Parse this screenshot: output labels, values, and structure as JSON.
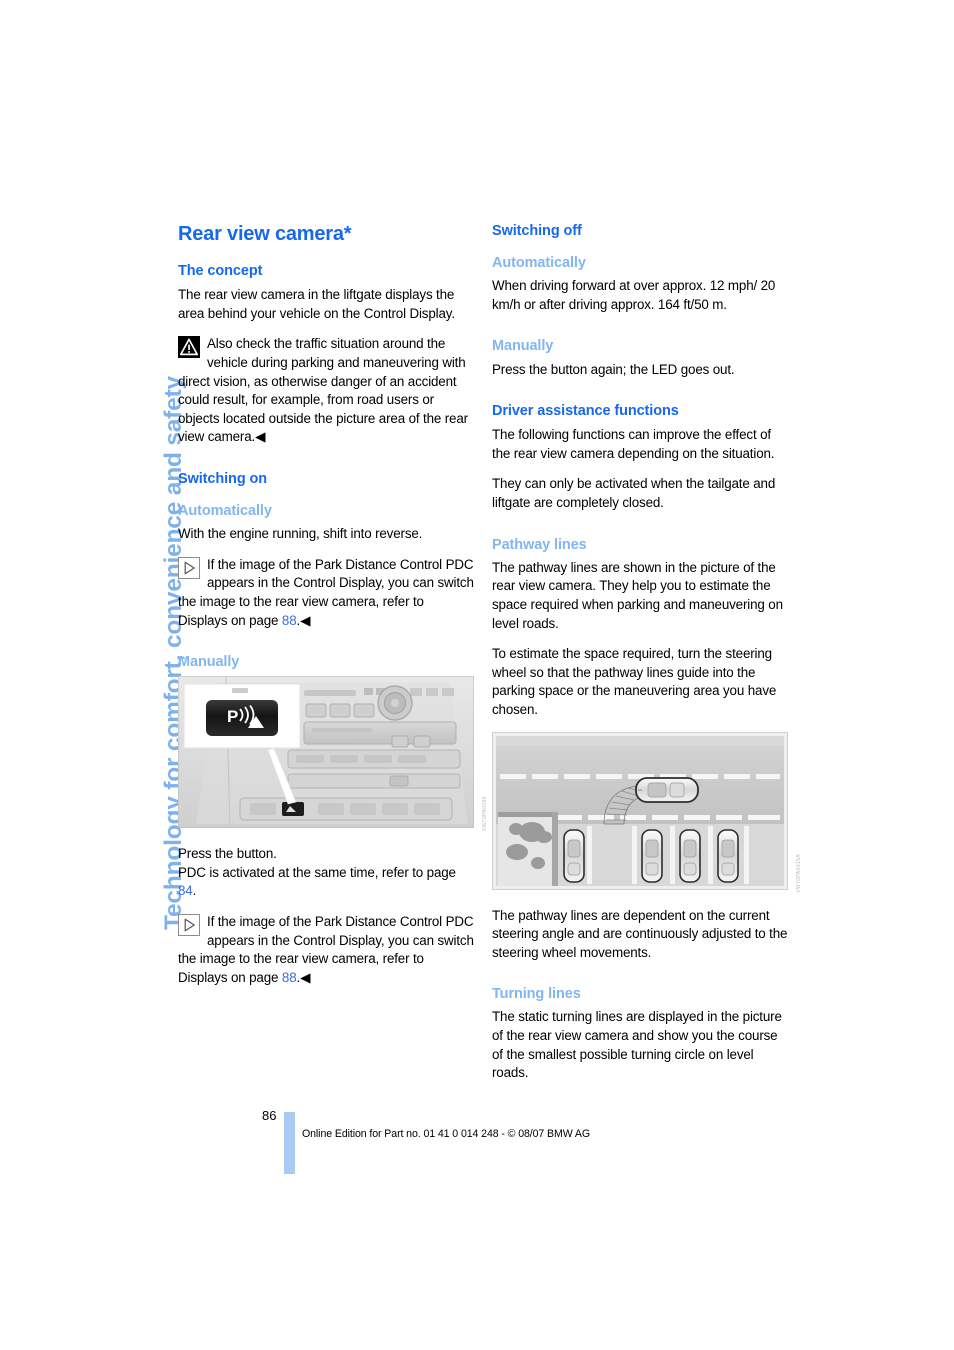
{
  "chapter_tab": "Technology for comfort, convenience and safety",
  "colors": {
    "heading_blue": "#1668f0",
    "subheading_blue": "#82b6ef",
    "page_ref_blue": "#3a6fe0",
    "footer_bar_blue": "#a8cbf2"
  },
  "left_column": {
    "title": "Rear view camera*",
    "section_concept": {
      "heading": "The concept",
      "paragraph": "The rear view camera in the liftgate displays the area behind your vehicle on the Control Display.",
      "warning": {
        "icon": "warning-triangle-icon",
        "text": "Also check the traffic situation around the vehicle during parking and maneuvering with direct vision, as otherwise danger of an accident could result, for example, from road users or objects located outside the picture area of the rear view camera.",
        "endmark": "◀"
      }
    },
    "section_switching_on": {
      "heading": "Switching on",
      "automatically": {
        "heading": "Automatically",
        "paragraph": "With the engine running, shift into reverse.",
        "note": {
          "icon": "info-play-icon",
          "text_before_ref": "If the image of the Park Distance Control PDC appears in the Control Display, you can switch the image to the rear view camera, refer to Displays on page ",
          "page_ref": "88",
          "text_after_ref": ".",
          "endmark": "◀"
        }
      },
      "manually": {
        "heading": "Manually",
        "figure": {
          "name": "pdc-button-center-console-photo",
          "watermark": "VW70PA0096"
        },
        "paragraph_line1": "Press the button.",
        "paragraph_line2_before_ref": "PDC is activated at the same time, refer to page ",
        "paragraph_line2_ref": "84",
        "paragraph_line2_after": ".",
        "note": {
          "icon": "info-play-icon",
          "text_before_ref": "If the image of the Park Distance Control PDC appears in the Control Display, you can switch the image to the rear view camera, refer to Displays on page ",
          "page_ref": "88",
          "text_after_ref": ".",
          "endmark": "◀"
        }
      }
    }
  },
  "right_column": {
    "section_switching_off": {
      "heading": "Switching off",
      "automatically": {
        "heading": "Automatically",
        "paragraph": "When driving forward at over approx. 12 mph/ 20 km/h or after driving approx. 164 ft/50 m."
      },
      "manually": {
        "heading": "Manually",
        "paragraph": "Press the button again; the LED goes out."
      }
    },
    "section_driver_assistance": {
      "heading": "Driver assistance functions",
      "paragraph1": "The following functions can improve the effect of the rear view camera depending on the situation.",
      "paragraph2": "They can only be activated when the tailgate and liftgate are completely closed."
    },
    "section_pathway_lines": {
      "heading": "Pathway lines",
      "paragraph1": "The pathway lines are shown in the picture of the rear view camera. They help you to estimate the space required when parking and maneuvering on level roads.",
      "paragraph2": "To estimate the space required, turn the steering wheel so that the pathway lines guide into the parking space or the maneuvering area you have chosen.",
      "figure": {
        "name": "pathway-lines-parking-diagram",
        "watermark": "VW70PA0015A"
      },
      "paragraph3": "The pathway lines are dependent on the current steering angle and are continuously adjusted to the steering wheel movements."
    },
    "section_turning_lines": {
      "heading": "Turning lines",
      "paragraph1": "The static turning lines are displayed in the picture of the rear view camera and show you the course of the smallest possible turning circle on level roads."
    }
  },
  "footer": {
    "page_number": "86",
    "edition_text": "Online Edition for Part no. 01 41 0 014 248 - © 08/07 BMW AG"
  }
}
